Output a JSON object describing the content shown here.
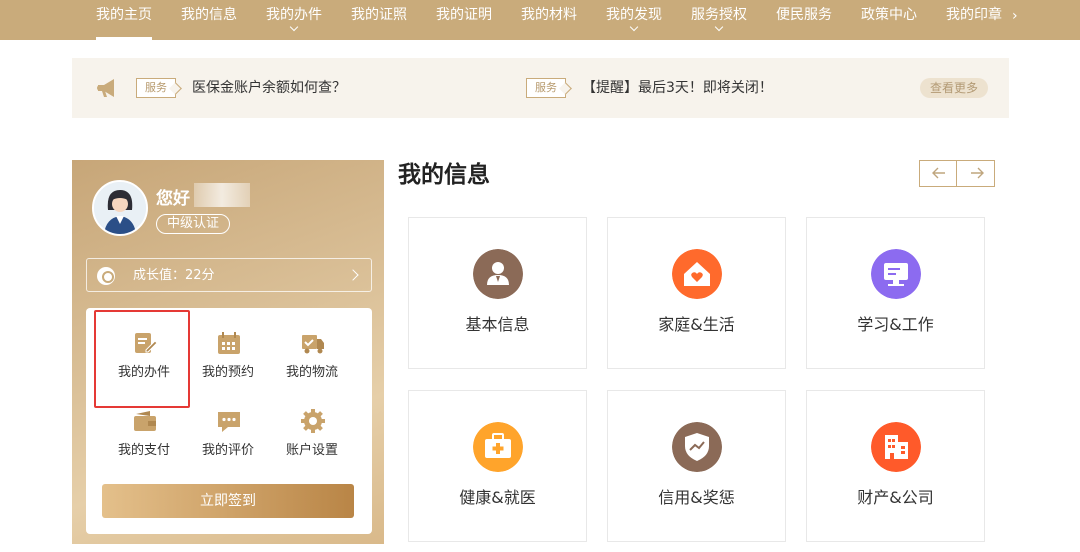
{
  "nav": {
    "items": [
      {
        "label": "我的主页",
        "active": true
      },
      {
        "label": "我的信息"
      },
      {
        "label": "我的办件",
        "dropdown": true
      },
      {
        "label": "我的证照"
      },
      {
        "label": "我的证明"
      },
      {
        "label": "我的材料"
      },
      {
        "label": "我的发现",
        "dropdown": true
      },
      {
        "label": "服务授权",
        "dropdown": true
      },
      {
        "label": "便民服务"
      },
      {
        "label": "政策中心"
      },
      {
        "label": "我的印章"
      }
    ],
    "more_icon": "chevron-right-icon"
  },
  "notice": {
    "items": [
      {
        "tag": "服务",
        "text": "医保金账户余额如何查？"
      },
      {
        "tag": "服务",
        "text": "【提醒】最后3天！即将关闭！"
      }
    ],
    "view_more": "查看更多"
  },
  "user": {
    "greeting": "您好",
    "level": "中级认证",
    "growth": "成长值：22分",
    "quick_actions": [
      {
        "label": "我的办件",
        "icon": "edit-document-icon"
      },
      {
        "label": "我的预约",
        "icon": "calendar-icon"
      },
      {
        "label": "我的物流",
        "icon": "delivery-truck-icon"
      },
      {
        "label": "我的支付",
        "icon": "wallet-icon"
      },
      {
        "label": "我的评价",
        "icon": "chat-bubble-icon"
      },
      {
        "label": "账户设置",
        "icon": "gear-icon"
      }
    ],
    "signin": "立即签到"
  },
  "info": {
    "title": "我的信息",
    "cards": [
      {
        "label": "基本信息",
        "icon": "person-icon",
        "color": "#8b6a57"
      },
      {
        "label": "家庭&生活",
        "icon": "home-heart-icon",
        "color": "#ff6a2c"
      },
      {
        "label": "学习&工作",
        "icon": "monitor-icon",
        "color": "#8c6bf0"
      },
      {
        "label": "健康&就医",
        "icon": "medical-kit-icon",
        "color": "#ffa42b"
      },
      {
        "label": "信用&奖惩",
        "icon": "shield-chart-icon",
        "color": "#8b6a57"
      },
      {
        "label": "财产&公司",
        "icon": "building-icon",
        "color": "#ff5a2a"
      }
    ]
  },
  "colors": {
    "nav_bg": "#c9ab7b",
    "accent": "#c9ab7b",
    "highlight": "#e53935"
  }
}
